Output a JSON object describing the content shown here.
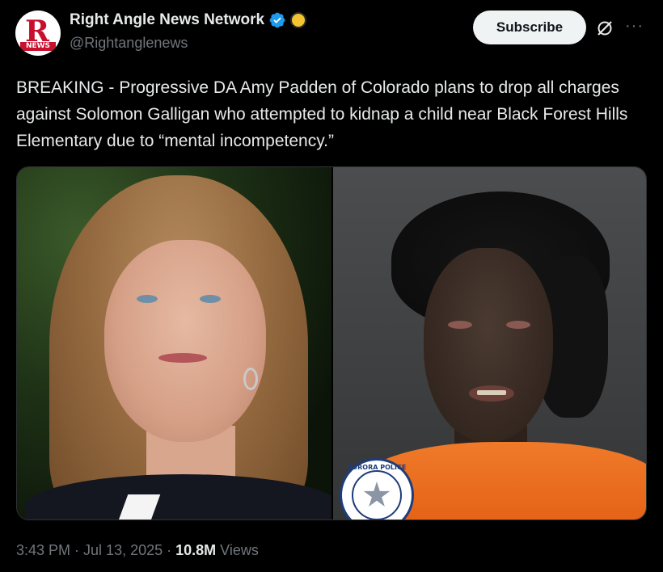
{
  "account": {
    "name": "Right Angle News Network",
    "handle": "@Rightanglenews",
    "avatar_text": "R",
    "avatar_sub": "NEWS"
  },
  "actions": {
    "subscribe_label": "Subscribe",
    "more_label": "···"
  },
  "post": {
    "text": "BREAKING - Progressive DA Amy Padden of Colorado plans to drop all charges against Solomon Galligan who attempted to kidnap a child near Black Forest Hills Elementary due to “mental incompetency.”",
    "badge_text": "AURORA POLICE"
  },
  "meta": {
    "time": "3:43 PM",
    "date": "Jul 13, 2025",
    "views_count": "10.8M",
    "views_label": "Views",
    "separator": "·"
  },
  "colors": {
    "background": "#000000",
    "text": "#e7e9ea",
    "muted": "#71767b",
    "verified": "#1d9bf0",
    "gold_badge": "#f4c430"
  }
}
